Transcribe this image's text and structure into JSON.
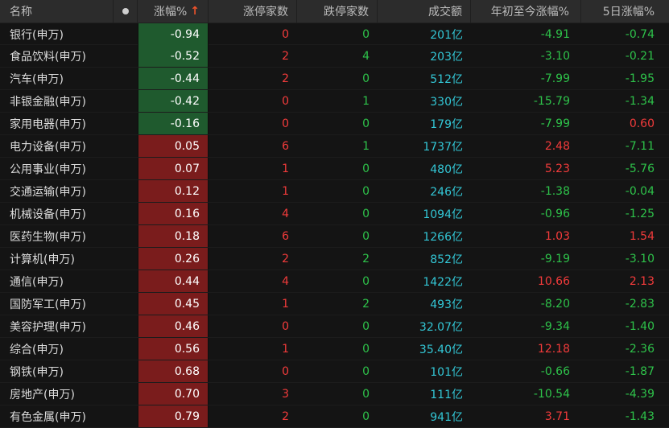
{
  "header": {
    "name": "名称",
    "change": "涨幅%",
    "sort_arrow": "↑",
    "limit_up": "涨停家数",
    "limit_down": "跌停家数",
    "volume": "成交额",
    "ytd": "年初至今涨幅%",
    "five_day": "5日涨幅%"
  },
  "colors": {
    "up": "#f23b3b",
    "down": "#2ec24a",
    "volume": "#33c7d6",
    "bar_up": "#7a1c1c",
    "bar_down": "#1f5a2e"
  },
  "rows": [
    {
      "name": "银行(申万)",
      "change": "-0.94",
      "up": "0",
      "down": "0",
      "volume": "201亿",
      "ytd": "-4.91",
      "d5": "-0.74"
    },
    {
      "name": "食品饮料(申万)",
      "change": "-0.52",
      "up": "2",
      "down": "4",
      "volume": "203亿",
      "ytd": "-3.10",
      "d5": "-0.21"
    },
    {
      "name": "汽车(申万)",
      "change": "-0.44",
      "up": "2",
      "down": "0",
      "volume": "512亿",
      "ytd": "-7.99",
      "d5": "-1.95"
    },
    {
      "name": "非银金融(申万)",
      "change": "-0.42",
      "up": "0",
      "down": "1",
      "volume": "330亿",
      "ytd": "-15.79",
      "d5": "-1.34"
    },
    {
      "name": "家用电器(申万)",
      "change": "-0.16",
      "up": "0",
      "down": "0",
      "volume": "179亿",
      "ytd": "-7.99",
      "d5": "0.60"
    },
    {
      "name": "电力设备(申万)",
      "change": "0.05",
      "up": "6",
      "down": "1",
      "volume": "1737亿",
      "ytd": "2.48",
      "d5": "-7.11"
    },
    {
      "name": "公用事业(申万)",
      "change": "0.07",
      "up": "1",
      "down": "0",
      "volume": "480亿",
      "ytd": "5.23",
      "d5": "-5.76"
    },
    {
      "name": "交通运输(申万)",
      "change": "0.12",
      "up": "1",
      "down": "0",
      "volume": "246亿",
      "ytd": "-1.38",
      "d5": "-0.04"
    },
    {
      "name": "机械设备(申万)",
      "change": "0.16",
      "up": "4",
      "down": "0",
      "volume": "1094亿",
      "ytd": "-0.96",
      "d5": "-1.25"
    },
    {
      "name": "医药生物(申万)",
      "change": "0.18",
      "up": "6",
      "down": "0",
      "volume": "1266亿",
      "ytd": "1.03",
      "d5": "1.54"
    },
    {
      "name": "计算机(申万)",
      "change": "0.26",
      "up": "2",
      "down": "2",
      "volume": "852亿",
      "ytd": "-9.19",
      "d5": "-3.10"
    },
    {
      "name": "通信(申万)",
      "change": "0.44",
      "up": "4",
      "down": "0",
      "volume": "1422亿",
      "ytd": "10.66",
      "d5": "2.13"
    },
    {
      "name": "国防军工(申万)",
      "change": "0.45",
      "up": "1",
      "down": "2",
      "volume": "493亿",
      "ytd": "-8.20",
      "d5": "-2.83"
    },
    {
      "name": "美容护理(申万)",
      "change": "0.46",
      "up": "0",
      "down": "0",
      "volume": "32.07亿",
      "ytd": "-9.34",
      "d5": "-1.40"
    },
    {
      "name": "综合(申万)",
      "change": "0.56",
      "up": "1",
      "down": "0",
      "volume": "35.40亿",
      "ytd": "12.18",
      "d5": "-2.36"
    },
    {
      "name": "钢铁(申万)",
      "change": "0.68",
      "up": "0",
      "down": "0",
      "volume": "101亿",
      "ytd": "-0.66",
      "d5": "-1.87"
    },
    {
      "name": "房地产(申万)",
      "change": "0.70",
      "up": "3",
      "down": "0",
      "volume": "111亿",
      "ytd": "-10.54",
      "d5": "-4.39"
    },
    {
      "name": "有色金属(申万)",
      "change": "0.79",
      "up": "2",
      "down": "0",
      "volume": "941亿",
      "ytd": "3.71",
      "d5": "-1.43"
    }
  ]
}
